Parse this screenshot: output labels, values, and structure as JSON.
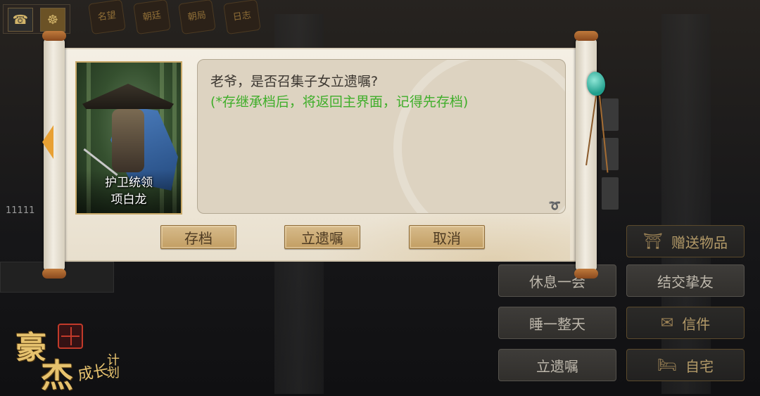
{
  "background": {
    "top_tabs": [
      "名望",
      "朝廷",
      "朝局",
      "日志"
    ],
    "left_value": "11111"
  },
  "dialog": {
    "character": {
      "title": "护卫统领",
      "name": "项白龙"
    },
    "message": "老爷，是否召集子女立遗嘱?",
    "hint": "(*存继承档后，将返回主界面，记得先存档)",
    "buttons": {
      "save": "存档",
      "will": "立遗嘱",
      "cancel": "取消"
    }
  },
  "actions": {
    "gift": "赠送物品",
    "rest": "休息一会",
    "befriend": "结交挚友",
    "sleep": "睡一整天",
    "letters": "信件",
    "will": "立遗嘱",
    "home": "自宅"
  },
  "logo": {
    "big1": "豪",
    "big2": "杰",
    "small1": "成长",
    "small2": "计划"
  },
  "colors": {
    "hint_green": "#3fae2a",
    "dialog_button": "#c29e63",
    "scroll_paper": "#f4efe4"
  }
}
